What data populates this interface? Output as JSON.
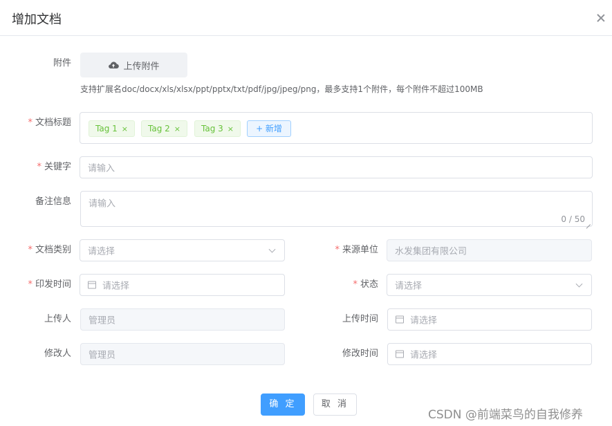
{
  "dialog": {
    "title": "增加文档"
  },
  "attachment": {
    "label": "附件",
    "upload_label": "上传附件",
    "hint": "支持扩展名doc/docx/xls/xlsx/ppt/pptx/txt/pdf/jpg/jpeg/png，最多支持1个附件，每个附件不超过100MB"
  },
  "doc_title": {
    "label": "文档标题",
    "tags": [
      {
        "label": "Tag 1"
      },
      {
        "label": "Tag 2"
      },
      {
        "label": "Tag 3"
      }
    ],
    "add_label": "+ 新增",
    "tag_close": "×"
  },
  "keyword": {
    "label": "关键字",
    "placeholder": "请输入"
  },
  "remark": {
    "label": "备注信息",
    "placeholder": "请输入",
    "counter": "0 / 50"
  },
  "doc_type": {
    "label": "文档类别",
    "placeholder": "请选择"
  },
  "source": {
    "label": "来源单位",
    "value": "水发集团有限公司"
  },
  "issue_time": {
    "label": "印发时间",
    "placeholder": "请选择"
  },
  "status": {
    "label": "状态",
    "placeholder": "请选择"
  },
  "uploader": {
    "label": "上传人",
    "value": "管理员"
  },
  "upload_time": {
    "label": "上传时间",
    "placeholder": "请选择"
  },
  "modifier": {
    "label": "修改人",
    "value": "管理员"
  },
  "modify_time": {
    "label": "修改时间",
    "placeholder": "请选择"
  },
  "footer": {
    "ok_label": "确 定",
    "cancel_label": "取 消"
  },
  "required_mark": "*",
  "watermark": "CSDN @前端菜鸟的自我修养",
  "colors": {
    "primary": "#409eff",
    "tag_green": "#67c23a",
    "required_red": "#f56c6c"
  }
}
